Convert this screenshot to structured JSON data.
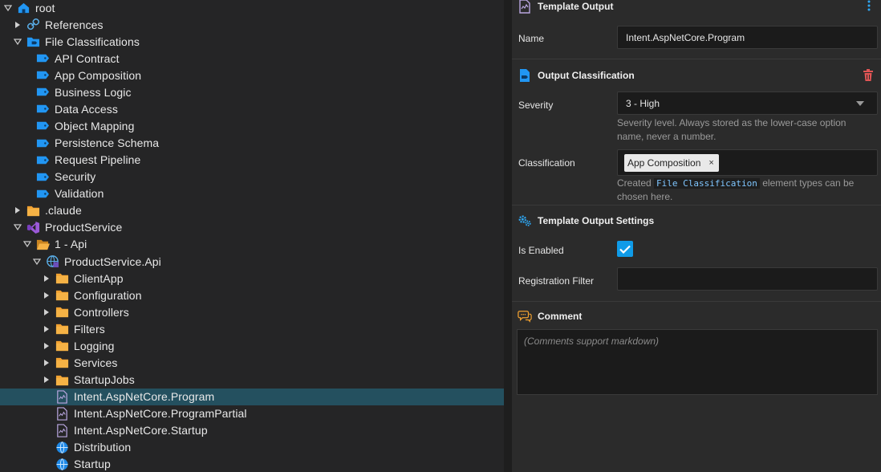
{
  "tree": {
    "rows": [
      {
        "label": "root",
        "icon": "home-icon",
        "indent": 0,
        "expander": "open"
      },
      {
        "label": "References",
        "icon": "link-icon",
        "indent": 1,
        "expander": "closed"
      },
      {
        "label": "File Classifications",
        "icon": "folder-blue-icon",
        "indent": 1,
        "expander": "open"
      },
      {
        "label": "API Contract",
        "icon": "tag-icon",
        "indent": 2,
        "expander": "none"
      },
      {
        "label": "App Composition",
        "icon": "tag-icon",
        "indent": 2,
        "expander": "none"
      },
      {
        "label": "Business Logic",
        "icon": "tag-icon",
        "indent": 2,
        "expander": "none"
      },
      {
        "label": "Data Access",
        "icon": "tag-icon",
        "indent": 2,
        "expander": "none"
      },
      {
        "label": "Object Mapping",
        "icon": "tag-icon",
        "indent": 2,
        "expander": "none"
      },
      {
        "label": "Persistence Schema",
        "icon": "tag-icon",
        "indent": 2,
        "expander": "none"
      },
      {
        "label": "Request Pipeline",
        "icon": "tag-icon",
        "indent": 2,
        "expander": "none"
      },
      {
        "label": "Security",
        "icon": "tag-icon",
        "indent": 2,
        "expander": "none"
      },
      {
        "label": "Validation",
        "icon": "tag-icon",
        "indent": 2,
        "expander": "none"
      },
      {
        "label": ".claude",
        "icon": "folder-icon",
        "indent": 1,
        "expander": "closed"
      },
      {
        "label": "ProductService",
        "icon": "visual-studio-icon",
        "indent": 1,
        "expander": "open"
      },
      {
        "label": "1 - Api",
        "icon": "folder-open-icon",
        "indent": 2,
        "expander": "open"
      },
      {
        "label": "ProductService.Api",
        "icon": "csharp-project-icon",
        "indent": 3,
        "expander": "open"
      },
      {
        "label": "ClientApp",
        "icon": "folder-icon",
        "indent": 4,
        "expander": "closed"
      },
      {
        "label": "Configuration",
        "icon": "folder-icon",
        "indent": 4,
        "expander": "closed"
      },
      {
        "label": "Controllers",
        "icon": "folder-icon",
        "indent": 4,
        "expander": "closed"
      },
      {
        "label": "Filters",
        "icon": "folder-icon",
        "indent": 4,
        "expander": "closed"
      },
      {
        "label": "Logging",
        "icon": "folder-icon",
        "indent": 4,
        "expander": "closed"
      },
      {
        "label": "Services",
        "icon": "folder-icon",
        "indent": 4,
        "expander": "closed"
      },
      {
        "label": "StartupJobs",
        "icon": "folder-icon",
        "indent": 4,
        "expander": "closed"
      },
      {
        "label": "Intent.AspNetCore.Program",
        "icon": "template-file-icon",
        "indent": 4,
        "expander": "none",
        "selected": true
      },
      {
        "label": "Intent.AspNetCore.ProgramPartial",
        "icon": "template-file-icon",
        "indent": 4,
        "expander": "none"
      },
      {
        "label": "Intent.AspNetCore.Startup",
        "icon": "template-file-icon",
        "indent": 4,
        "expander": "none"
      },
      {
        "label": "Distribution",
        "icon": "globe-icon",
        "indent": 4,
        "expander": "none"
      },
      {
        "label": "Startup",
        "icon": "globe-icon",
        "indent": 4,
        "expander": "none"
      }
    ]
  },
  "properties": {
    "template_output": {
      "title": "Template Output",
      "name_label": "Name",
      "name_value": "Intent.AspNetCore.Program"
    },
    "output_classification": {
      "title": "Output Classification",
      "severity_label": "Severity",
      "severity_value": "3 - High",
      "severity_hint": "Severity level. Always stored as the lower-case option name, never a number.",
      "classification_label": "Classification",
      "classification_tag": "App Composition",
      "tag_remove": "×",
      "hint_prefix": "Created",
      "hint_code": "File Classification",
      "hint_suffix": "element types can be chosen here."
    },
    "template_output_settings": {
      "title": "Template Output Settings",
      "is_enabled_label": "Is Enabled",
      "registration_filter_label": "Registration Filter",
      "registration_filter_value": ""
    },
    "comment": {
      "title": "Comment",
      "placeholder": "(Comments support markdown)"
    }
  },
  "colors": {
    "accent_blue": "#0f9be8",
    "selected_row": "#24505f",
    "folder_orange": "#f0a030",
    "delete_red": "#e05555"
  }
}
